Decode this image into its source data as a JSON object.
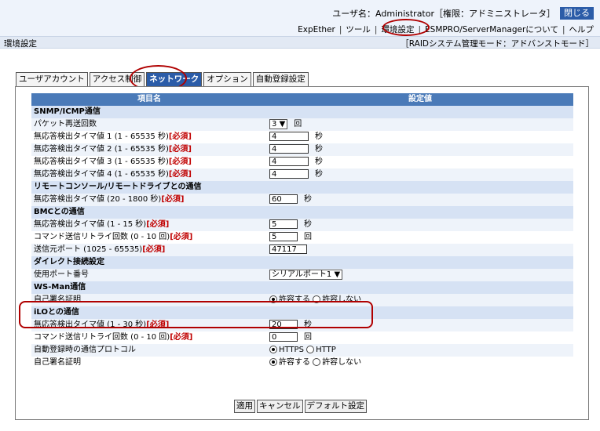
{
  "header": {
    "user_label": "ユーザ名：Administrator［権限：アドミニストレータ］",
    "close_label": "閉じる",
    "links": [
      "ExpEther",
      "ツール",
      "環境設定",
      "ESMPRO/ServerManagerについて",
      "ヘルプ"
    ],
    "separator": "|"
  },
  "breadcrumb": {
    "left": "環境設定",
    "right": "［RAIDシステム管理モード：アドバンストモード］"
  },
  "tabs": [
    "ユーザアカウント",
    "アクセス制御",
    "ネットワーク",
    "オプション",
    "自動登録設定"
  ],
  "active_tab": "ネットワーク",
  "table": {
    "headers": [
      "項目名",
      "設定値"
    ],
    "sections": {
      "snmp": "SNMP/ICMP通信",
      "remote": "リモートコンソール/リモートドライブとの通信",
      "bmc": "BMCとの通信",
      "direct": "ダイレクト接続設定",
      "wsman": "WS-Man通信",
      "ilo": "iLOとの通信"
    },
    "required": "[必須]",
    "rows": {
      "snmp_retry": {
        "label": "パケット再送回数",
        "value": "3",
        "unit": "回"
      },
      "snmp_t1": {
        "label": "無応答検出タイマ値 1 (1 - 65535 秒)",
        "value": "4",
        "unit": "秒"
      },
      "snmp_t2": {
        "label": "無応答検出タイマ値 2 (1 - 65535 秒)",
        "value": "4",
        "unit": "秒"
      },
      "snmp_t3": {
        "label": "無応答検出タイマ値 3 (1 - 65535 秒)",
        "value": "4",
        "unit": "秒"
      },
      "snmp_t4": {
        "label": "無応答検出タイマ値 4 (1 - 65535 秒)",
        "value": "4",
        "unit": "秒"
      },
      "remote_t": {
        "label": "無応答検出タイマ値 (20 - 1800 秒)",
        "value": "60",
        "unit": "秒"
      },
      "bmc_t": {
        "label": "無応答検出タイマ値 (1 - 15 秒)",
        "value": "5",
        "unit": "秒"
      },
      "bmc_retry": {
        "label": "コマンド送信リトライ回数 (0 - 10 回)",
        "value": "5",
        "unit": "回"
      },
      "bmc_port": {
        "label": "送信元ポート (1025 - 65535)",
        "value": "47117"
      },
      "direct_port": {
        "label": "使用ポート番号",
        "value": "シリアルポート1"
      },
      "wsman_cert": {
        "label": "自己署名証明",
        "option_on": "許容する",
        "option_off": "許容しない"
      },
      "ilo_t": {
        "label": "無応答検出タイマ値 (1 - 30 秒)",
        "value": "20",
        "unit": "秒"
      },
      "ilo_retry": {
        "label": "コマンド送信リトライ回数 (0 - 10 回)",
        "value": "0",
        "unit": "回"
      },
      "ilo_proto": {
        "label": "自動登録時の通信プロトコル",
        "option_on": "HTTPS",
        "option_off": "HTTP"
      },
      "ilo_cert": {
        "label": "自己署名証明",
        "option_on": "許容する",
        "option_off": "許容しない"
      }
    }
  },
  "buttons": {
    "apply": "適用",
    "cancel": "キャンセル",
    "default": "デフォルト設定"
  },
  "colors": {
    "accent": "#2b5ca8",
    "header": "#4a7ab8",
    "highlight": "#b00000"
  }
}
